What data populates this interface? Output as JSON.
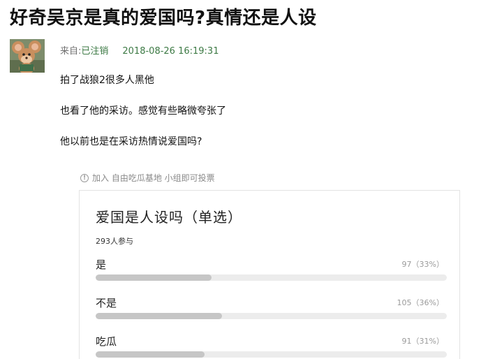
{
  "post": {
    "title": "好奇吴京是真的爱国吗?真情还是人设",
    "from_label": "来自:",
    "author": "已注销",
    "timestamp": "2018-08-26 16:19:31",
    "lines": [
      "拍了战狼2很多人黑他",
      "也看了他的采访。感觉有些略微夸张了",
      "他以前也是在采访热情说爱国吗?"
    ]
  },
  "vote_hint": "加入 自由吃瓜基地 小组即可投票",
  "poll": {
    "title": "爱国是人设吗（单选）",
    "participants": "293人参与",
    "options": [
      {
        "label": "是",
        "value_text": "97（33%）",
        "percent": 33
      },
      {
        "label": "不是",
        "value_text": "105（36%）",
        "percent": 36
      },
      {
        "label": "吃瓜",
        "value_text": "91（31%）",
        "percent": 31
      }
    ]
  },
  "colors": {
    "author_link": "#3d7a45",
    "bar_fill": "#c6c6c6",
    "bar_track": "#ececec"
  },
  "icons": {
    "info": "info-circle-icon",
    "avatar": "jerry-mouse-avatar"
  }
}
